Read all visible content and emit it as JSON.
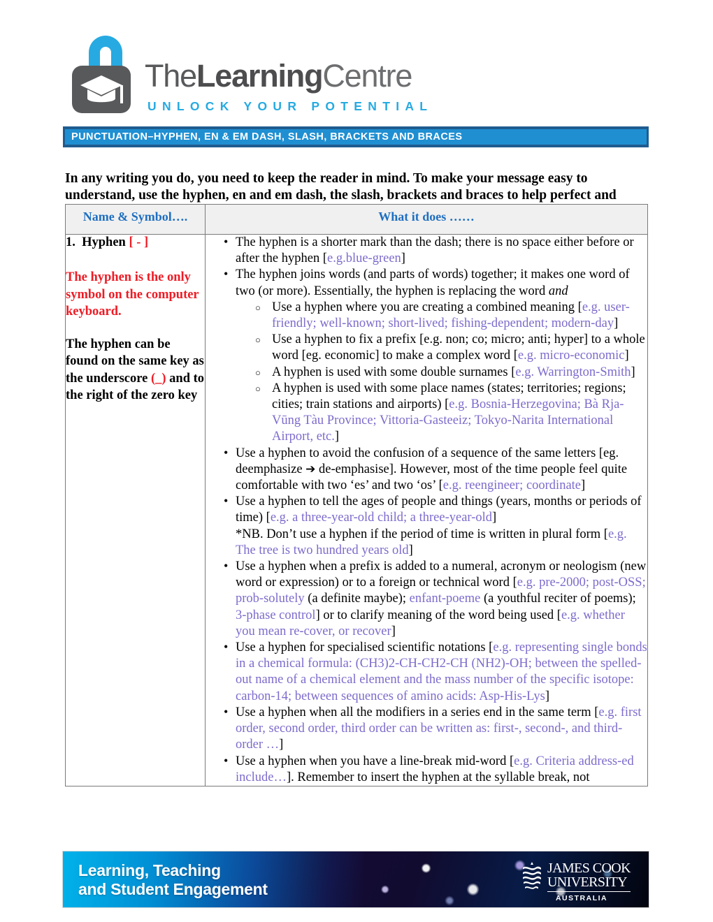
{
  "logo": {
    "icon": "open-padlock-graduation-cap-icon",
    "word_the": "The",
    "word_learning": "Learning",
    "word_centre": "Centre",
    "tagline": "UNLOCK YOUR POTENTIAL",
    "colors": {
      "cyan": "#27AAE1",
      "gray": "#58595B"
    }
  },
  "banner": {
    "title": "PUNCTUATION–HYPHEN, EN & EM DASH, SLASH, BRACKETS AND BRACES",
    "bg": "#1F8FD2",
    "border": "#1F5C8F"
  },
  "intro": {
    "text": "In any writing you do, you need to keep the reader in mind. To make your message easy to understand, use the hyphen, en and em dash, the slash, brackets and braces to help perfect and emphasise what you mean."
  },
  "table": {
    "headers": {
      "col1": "Name & Symbol….",
      "col2": "What it does ……",
      "header_text_color": "#1F6FC0",
      "header_bg": "#F0F0F0"
    },
    "left_cell": {
      "item_number": "1.",
      "item_name": "Hyphen",
      "item_symbol": "[ - ]",
      "red_note": "The hyphen is the only symbol on the computer keyboard.",
      "black_note_a": "The hyphen can be found on the same key as the underscore",
      "black_note_symbol": "(_)",
      "black_note_b": "and to the right of the zero key",
      "red_color": "#EE1C25"
    },
    "right_cell": {
      "example_color": "#7E6BCC",
      "bullets": [
        {
          "pre": "The hyphen is a shorter mark than the dash; there is no space either before or after the hyphen [",
          "ex": "e.g.blue-green",
          "post": "]"
        },
        {
          "pre": "The hyphen joins words (and parts of words) together; it makes one word of two (or more). Essentially, the hyphen is replacing the word ",
          "italic": "and",
          "post": "",
          "subs": [
            {
              "pre": "Use a hyphen where you are creating a combined meaning [",
              "ex": "e.g. user-friendly; well-known; short-lived; fishing-dependent; modern-day",
              "post": "]"
            },
            {
              "pre": "Use a hyphen to fix a prefix [e.g. non; co; micro; anti; hyper] to a whole word [eg. economic] to make a complex word [",
              "ex": "e.g. micro-economic",
              "post": "]"
            },
            {
              "pre": "A hyphen is used with some double surnames [",
              "ex": "e.g. Warrington-Smith",
              "post": "]"
            },
            {
              "pre": "A hyphen is used with some place names (states; territories; regions; cities; train stations and airports) [",
              "ex": "e.g. Bosnia-Herzegovina; Bà Rja-Vūng Tàu Province; Vittoria-Gasteeiz; Tokyo-Narita International Airport, etc.",
              "post": "]"
            }
          ]
        },
        {
          "pre": "Use a hyphen to avoid the confusion of a sequence of the same letters [eg. deemphasize ",
          "arrow": "➔",
          "mid": " de-emphasise]. However, most of the time people feel quite comfortable with two ‘es’ and two ‘os’ [",
          "ex": "e.g. reengineer; coordinate",
          "post": "]"
        },
        {
          "pre": "Use a hyphen to tell the ages of people and things (years, months or periods of time) [",
          "ex": "e.g. a three-year-old child; a three-year-old",
          "post": "]",
          "extra_pre": "*NB. Don’t use a hyphen if the period of time is written in plural form [",
          "extra_ex": "e.g. The tree is two hundred years old",
          "extra_post": "]"
        },
        {
          "pre": "Use a hyphen when a prefix is added to a numeral, acronym or neologism (new word or expression) or to a foreign or technical word [",
          "ex": "e.g. pre-2000; post-OSS; prob-solutely",
          "mid": " (a definite maybe); ",
          "ex2": "enfant-poeme",
          "mid2": " (a youthful reciter of poems); ",
          "ex3": "3-phase control",
          "mid3": "] or to clarify meaning of the word being used [",
          "ex4": "e.g. whether you mean re-cover, or recover",
          "post": "]"
        },
        {
          "pre": "Use a hyphen for specialised scientific notations [",
          "ex": "e.g. representing single bonds in a chemical formula: (CH3)2-CH-CH2-CH (NH2)-OH; between the spelled-out name of a chemical element and the mass number of the specific isotope:  carbon-14; between sequences of amino acids: Asp-His-Lys",
          "post": "]"
        },
        {
          "pre": "Use a hyphen when all the modifiers in a series end in the same term [",
          "ex": "e.g. first order, second order, third order can be written as: first-, second-, and third-order …",
          "post": "]"
        },
        {
          "pre": "Use a hyphen when you have a line-break mid-word [",
          "ex": "e.g. Criteria address-ed include…",
          "post": "]. Remember to insert the hyphen at the syllable break, not"
        }
      ]
    }
  },
  "footer": {
    "title_line1": "Learning, Teaching",
    "title_line2": "and Student Engagement",
    "university_line1": "JAMES COOK",
    "university_line2": "UNIVERSITY",
    "university_line3": "AUSTRALIA",
    "crest_icon": "jcu-wave-crest-icon"
  }
}
